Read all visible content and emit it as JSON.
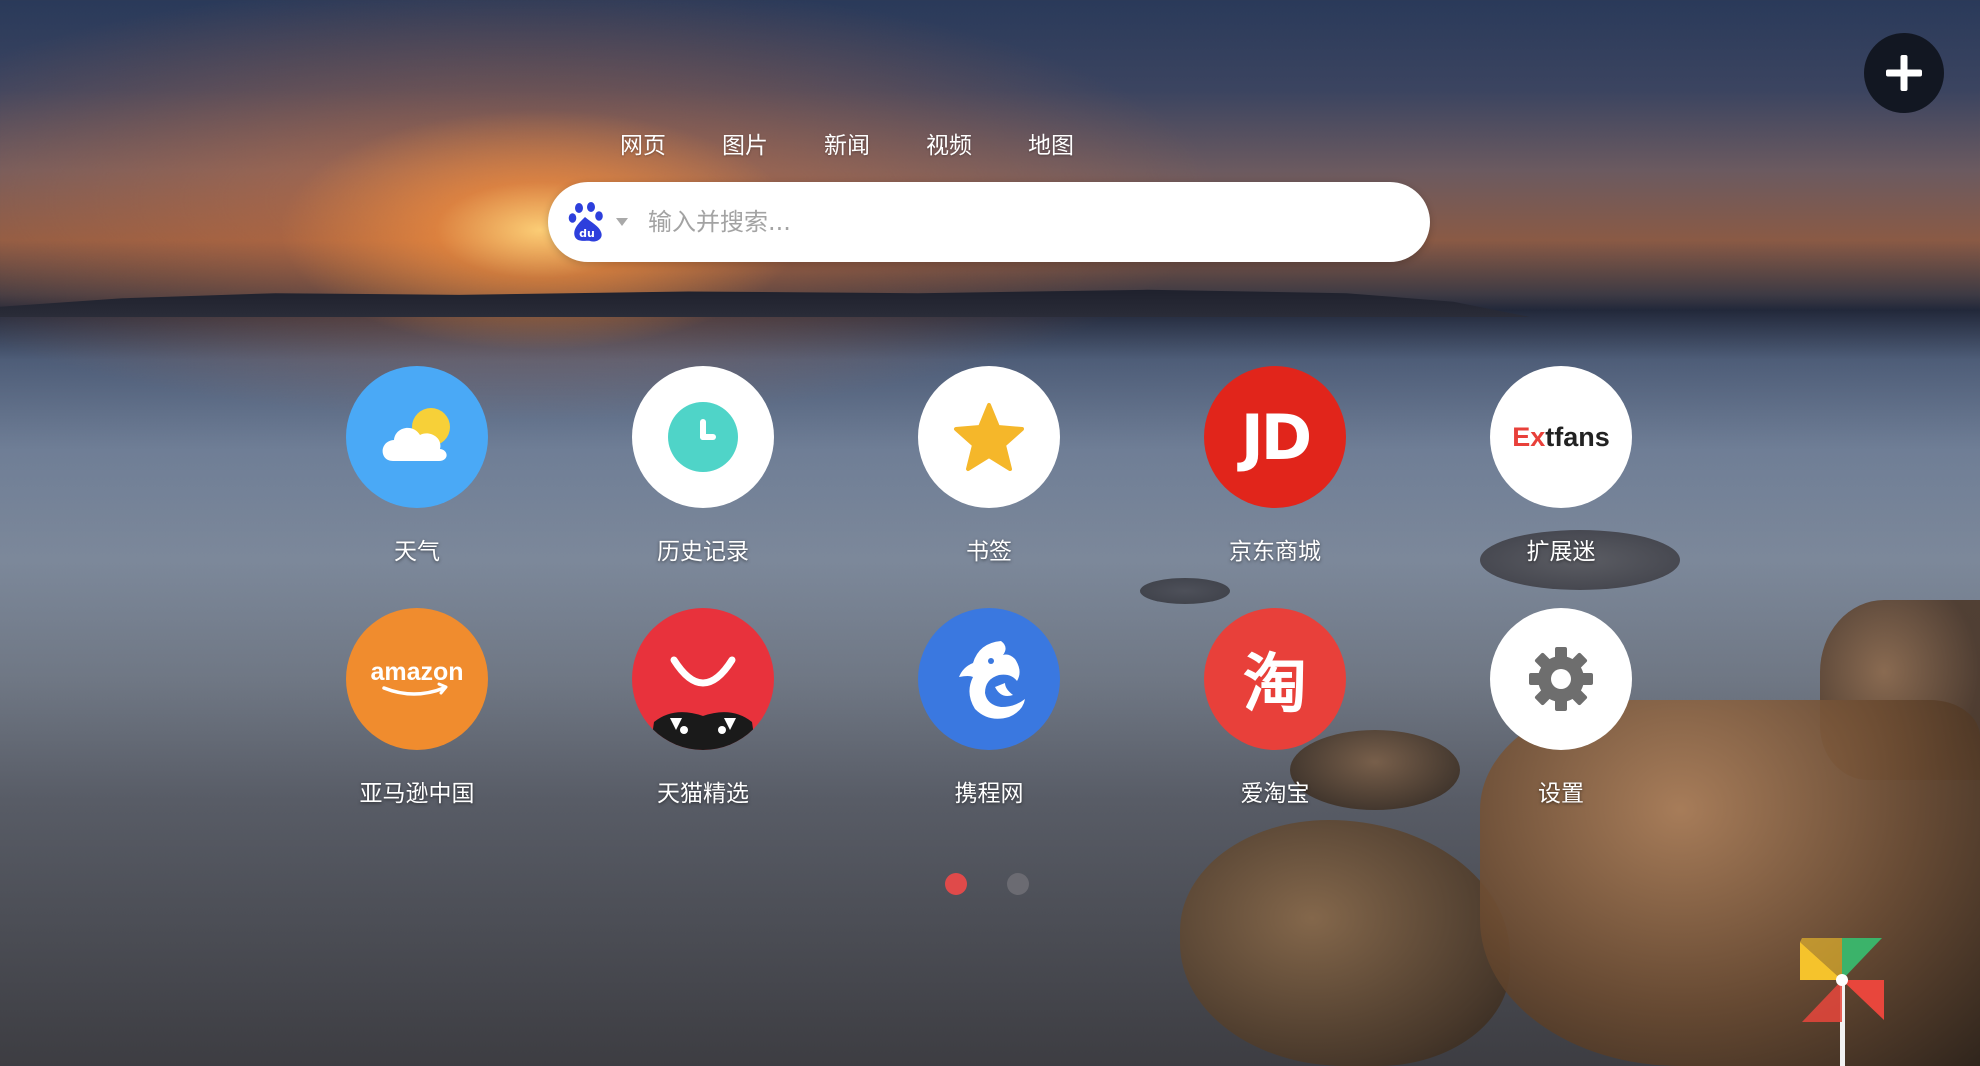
{
  "search": {
    "tabs": [
      "网页",
      "图片",
      "新闻",
      "视频",
      "地图"
    ],
    "placeholder": "输入并搜索...",
    "engine_icon": "baidu-paw-icon"
  },
  "apps": [
    {
      "label": "天气",
      "icon": "weather-icon",
      "color": "#4aa9f6"
    },
    {
      "label": "历史记录",
      "icon": "clock-icon",
      "color": "#ffffff"
    },
    {
      "label": "书签",
      "icon": "star-icon",
      "color": "#ffffff"
    },
    {
      "label": "京东商城",
      "icon": "jd-logo-icon",
      "color": "#e1251b",
      "logo_text": "JD"
    },
    {
      "label": "扩展迷",
      "icon": "extfans-logo-icon",
      "color": "#ffffff",
      "logo_text_a": "Ex",
      "logo_text_b": "tfans"
    },
    {
      "label": "亚马逊中国",
      "icon": "amazon-logo-icon",
      "color": "#f08c2e",
      "logo_text": "amazon"
    },
    {
      "label": "天猫精选",
      "icon": "tmall-logo-icon",
      "color": "#e8323c"
    },
    {
      "label": "携程网",
      "icon": "ctrip-dolphin-icon",
      "color": "#3a78e0"
    },
    {
      "label": "爱淘宝",
      "icon": "taobao-logo-icon",
      "color": "#e8403a",
      "logo_text": "淘"
    },
    {
      "label": "设置",
      "icon": "gear-icon",
      "color": "#ffffff"
    }
  ],
  "pagination": {
    "pages": 2,
    "current": 1,
    "active_color": "#e04a4a",
    "inactive_color": "#6b6b72"
  },
  "colors": {
    "accent": "#e04a4a",
    "search_bg": "#ffffff"
  }
}
